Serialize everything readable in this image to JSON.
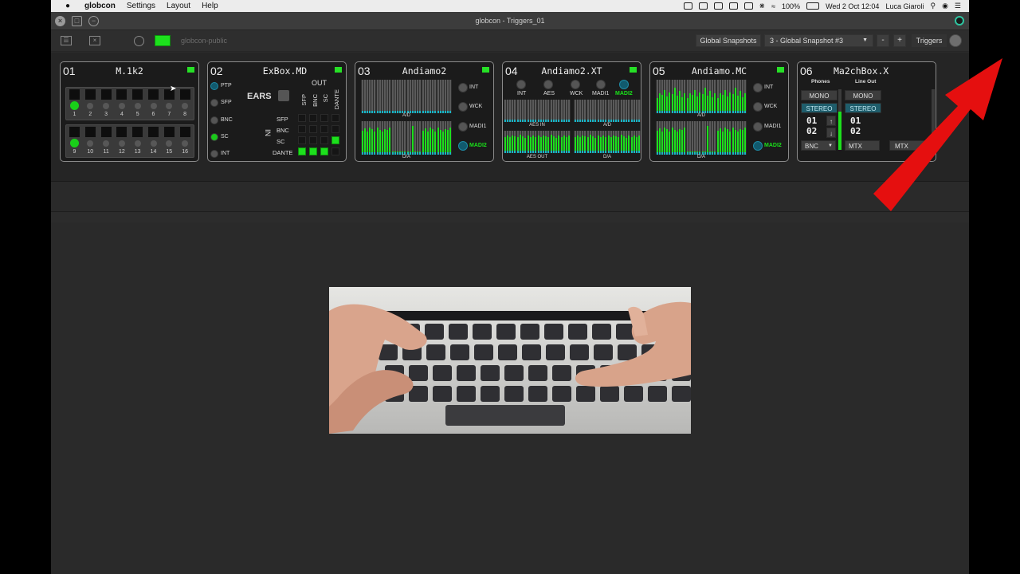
{
  "menubar": {
    "app_name": "globcon",
    "items": [
      "Settings",
      "Layout",
      "Help"
    ],
    "battery": "100%",
    "clock": "Wed 2 Oct  12:04",
    "user": "Luca Giaroli"
  },
  "window": {
    "title": "globcon - Triggers_01"
  },
  "toolbar": {
    "network_name": "globcon-public",
    "global_snapshots_label": "Global Snapshots",
    "snapshot_selected": "3 - Global Snapshot #3",
    "minus_label": "-",
    "plus_label": "+",
    "triggers_label": "Triggers"
  },
  "devices": [
    {
      "index": "01",
      "name": "M.1k2"
    },
    {
      "index": "02",
      "name": "ExBox.MD"
    },
    {
      "index": "03",
      "name": "Andiamo2"
    },
    {
      "index": "04",
      "name": "Andiamo2.XT"
    },
    {
      "index": "05",
      "name": "Andiamo.MC"
    },
    {
      "index": "06",
      "name": "Ma2chBox.X"
    }
  ],
  "m1k2": {
    "row1_labels": [
      "1",
      "2",
      "3",
      "4",
      "5",
      "6",
      "7",
      "8"
    ],
    "row2_labels": [
      "9",
      "10",
      "11",
      "12",
      "13",
      "14",
      "15",
      "16"
    ]
  },
  "exbox": {
    "clocks": [
      "PTP",
      "SFP",
      "BNC",
      "SC",
      "INT"
    ],
    "ears_label": "EARS",
    "out_label": "OUT",
    "out_cols": [
      "SFP",
      "BNC",
      "SC",
      "DANTE"
    ],
    "in_label": "IN",
    "in_rows": [
      "SFP",
      "BNC",
      "SC",
      "DANTE"
    ]
  },
  "andiamo2": {
    "clocks": [
      "INT",
      "WCK",
      "MADI1",
      "MADI2"
    ],
    "top_label": "A/D",
    "bottom_label": "D/A"
  },
  "andiamo2xt": {
    "clocks": [
      "INT",
      "AES",
      "WCK",
      "MADI1",
      "MADI2"
    ],
    "labels": [
      "AES IN",
      "A/D",
      "AES OUT",
      "D/A"
    ]
  },
  "andiamomc": {
    "clocks": [
      "INT",
      "WCK",
      "MADI1",
      "MADI2"
    ],
    "top_label": "A/D",
    "bottom_label": "D/A"
  },
  "machbox": {
    "col1_title": "Phones",
    "col2_title": "Line Out",
    "mono": "MONO",
    "stereo": "STEREO",
    "ch_a": "01",
    "ch_b": "02",
    "sel1": "BNC",
    "sel2": "MTX",
    "sel3": "MTX"
  },
  "colors": {
    "accent_green": "#1de01d",
    "accent_teal": "#1f5d6b",
    "arrow_red": "#e50f0f"
  }
}
